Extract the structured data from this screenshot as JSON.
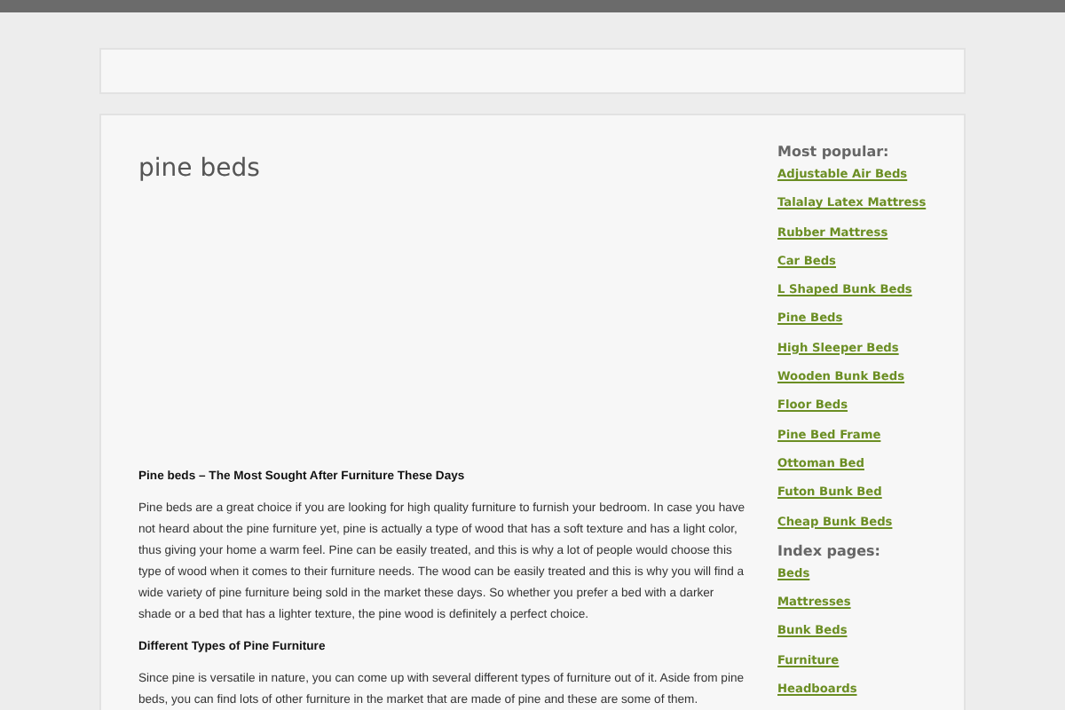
{
  "page": {
    "title": "pine beds"
  },
  "article": [
    {
      "kind": "heading",
      "text": "Pine beds – The Most Sought After Furniture These Days"
    },
    {
      "kind": "paragraph",
      "text": "Pine beds are a great choice if you are looking for high quality furniture to furnish your bedroom. In case you have not heard about the pine furniture yet, pine is actually a type of wood that has a soft texture and has a light color, thus giving your home a warm feel. Pine can be easily treated, and this is why a lot of people would choose this type of wood when it comes to their furniture needs. The wood can be easily treated and this is why you will find a wide variety of pine furniture being sold in the market these days. So whether you prefer a bed with a darker shade or a bed that has a lighter texture, the pine wood is definitely a perfect choice."
    },
    {
      "kind": "heading",
      "text": "Different Types of Pine Furniture"
    },
    {
      "kind": "paragraph",
      "text": "Since pine is versatile in nature, you can come up with several different types of furniture out of it. Aside from pine beds, you can find lots of other furniture in the market that are made of pine and these are some of them."
    }
  ],
  "sidebar": [
    {
      "title": "Most popular:",
      "links": [
        "Adjustable Air Beds",
        "Talalay Latex Mattress",
        "Rubber Mattress",
        "Car Beds",
        "L Shaped Bunk Beds",
        "Pine Beds",
        "High Sleeper Beds",
        "Wooden Bunk Beds",
        "Floor Beds",
        "Pine Bed Frame",
        "Ottoman Bed",
        "Futon Bunk Bed",
        "Cheap Bunk Beds"
      ]
    },
    {
      "title": "Index pages:",
      "links": [
        "Beds",
        "Mattresses",
        "Bunk Beds",
        "Furniture",
        "Headboards"
      ]
    }
  ]
}
